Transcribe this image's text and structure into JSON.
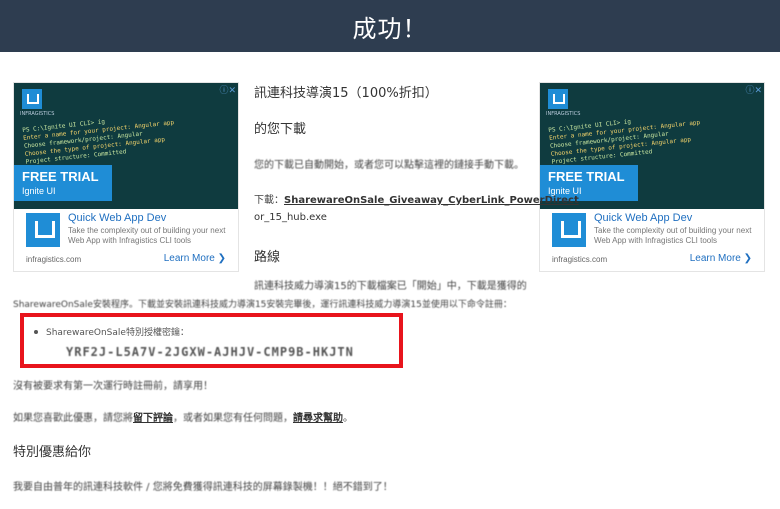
{
  "header": {
    "title": "成功！"
  },
  "ad": {
    "close": "ⓘ✕",
    "logo_text": "INFRAGISTICS",
    "code_lines": [
      "PS C:\\Ignite UI CLI> ig",
      "Enter a name for your project:  Angular app",
      "Choose framework/project: Angular",
      "Choose the type of project: Angular app",
      "Project structure: Committed",
      "Project",
      "(Use arrow keys)"
    ],
    "banner_title": "FREE TRIAL",
    "banner_sub": "Ignite UI",
    "title": "Quick Web App Dev",
    "desc": "Take the complexity out of building your next Web App with Infragistics CLI tools",
    "domain": "infragistics.com",
    "learn": "Learn More ❯"
  },
  "main": {
    "product_title": "訊連科技導演15（100%折扣）",
    "download_heading": "的您下載",
    "download_text": "您的下載已自動開始，或者您可以點擊這裡的鏈接手動下載。",
    "download_prefix": "下載：",
    "download_link": "SharewareOnSale_Giveaway_CyberLink_PowerDirect",
    "download_link2": "or_15_hub.exe",
    "route_heading": "路線",
    "route_text1": "訊連科技威力導演15的下載檔案已「開始」中，下載是獲得的",
    "route_text2": "SharewareOnSale安裝程序。下載並安裝訊連科技威力導演15安裝完畢後，運行訊連科技威力導演15並使用以下命令註冊：",
    "key_label": "SharewareOnSale特別授權密鑰：",
    "key_value": "YRF2J-L5A7V-2JGXW-AJHJV-CMP9B-HKJTN",
    "enjoy_text": "沒有被要求有第一次運行時註冊前，請享用！",
    "help_prefix": "如果您喜歡此優惠，請您將",
    "help_link1": "留下評論",
    "help_mid": "，或者如果您有任何問題，",
    "help_link2": "請尋求幫助",
    "help_suffix": "。",
    "special_heading": "特別優惠給你",
    "special_text": "我要自由普年的訊連科技軟件 / 您將免費獲得訊連科技的屏幕錄製機！！絕不錯到了！"
  }
}
